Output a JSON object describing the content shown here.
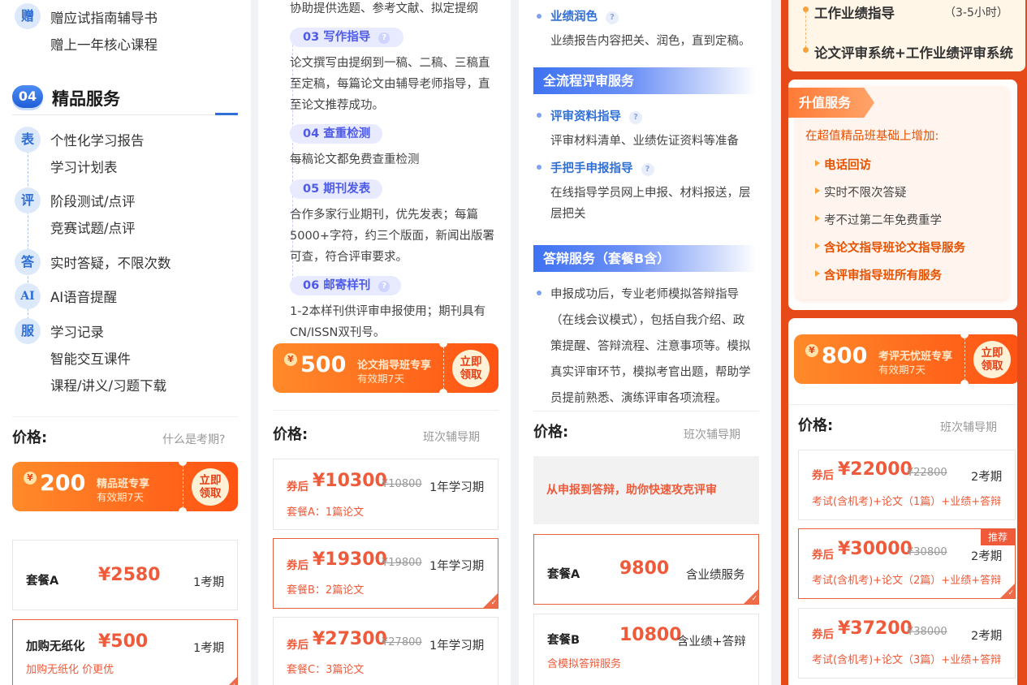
{
  "col1": {
    "gift_icon": "赠",
    "gift_items": [
      "赠应试指南辅导书",
      "赠上一年核心课程"
    ],
    "section_num": "04",
    "section_title": "精品服务",
    "groups": [
      {
        "icon": "表",
        "items": [
          "个性化学习报告",
          "学习计划表"
        ]
      },
      {
        "icon": "评",
        "items": [
          "阶段测试/点评",
          "竞赛试题/点评"
        ]
      },
      {
        "icon": "答",
        "items": [
          "实时答疑，不限次数"
        ]
      },
      {
        "icon": "AI",
        "items": [
          "AI语音提醒"
        ]
      },
      {
        "icon": "服",
        "items": [
          "学习记录",
          "智能交互课件",
          "课程/讲义/习题下载"
        ]
      }
    ],
    "price_label": "价格:",
    "price_note": "什么是考期?",
    "coupon": {
      "yen": "¥",
      "amount": "200",
      "title": "精品班专享",
      "sub": "有效期7天",
      "claim1": "立即",
      "claim2": "领取"
    },
    "plans": [
      {
        "name": "套餐A",
        "price": "¥2580",
        "period": "1考期",
        "sub": ""
      },
      {
        "name": "加购无纸化",
        "price": "¥500",
        "period": "1考期",
        "sub": "加购无纸化 价更优"
      }
    ]
  },
  "col2": {
    "top_text": "协助提供选题、参考文献、拟定提纲",
    "steps": [
      {
        "label": "03 写作指导",
        "text": [
          "论文撰写由提纲到一稿、二稿、三稿直",
          "至定稿，每篇论文由辅导老师指导，直",
          "至论文推荐成功。"
        ]
      },
      {
        "label": "04 查重检测",
        "text": [
          "每稿论文都免费查重检测"
        ]
      },
      {
        "label": "05 期刊发表",
        "text": [
          "合作多家行业期刊，优先发表；每篇",
          "5000+字符，约三个版面，新闻出版署",
          "可查，符合评审要求。"
        ]
      },
      {
        "label": "06 邮寄样刊",
        "text": [
          "1-2本样刊供评审申报使用；期刊具有",
          "CN/ISSN双刊号。"
        ]
      }
    ],
    "coupon": {
      "yen": "¥",
      "amount": "500",
      "title": "论文指导班专享",
      "sub": "有效期7天",
      "claim1": "立即",
      "claim2": "领取"
    },
    "price_label": "价格:",
    "price_note": "班次辅导期",
    "plans": [
      {
        "qh": "券后",
        "price": "¥10300",
        "orig": "¥10800",
        "period": "1年学习期",
        "sub": "套餐A：1篇论文"
      },
      {
        "qh": "券后",
        "price": "¥19300",
        "orig": "¥19800",
        "period": "1年学习期",
        "sub": "套餐B：2篇论文"
      },
      {
        "qh": "券后",
        "price": "¥27300",
        "orig": "¥27800",
        "period": "1年学习期",
        "sub": "套餐C：3篇论文"
      }
    ]
  },
  "col3": {
    "item1": {
      "title": "业绩润色",
      "text": "业绩报告内容把关、润色，直到定稿。"
    },
    "bar1": "全流程评审服务",
    "item2": {
      "title": "评审资料指导",
      "text": "评审材料清单、业绩佐证资料等准备"
    },
    "item3": {
      "title": "手把手申报指导",
      "text": [
        "在线指导学员网上申报、材料报送，层",
        "层把关"
      ]
    },
    "bar2": "答辩服务（套餐B含）",
    "item4": {
      "text": [
        "申报成功后，专业老师模拟答辩指导",
        "（在线会议模式），包括自我介绍、政",
        "策提醒、答辩流程、注意事项等。模拟",
        "真实评审环节，模拟考官出题，帮助学",
        "员提前熟悉、演练评审各项流程。"
      ]
    },
    "price_label": "价格:",
    "price_note": "班次辅导期",
    "banner": "从申报到答辩，助你快速攻克评审",
    "plans": [
      {
        "name": "套餐A",
        "price": "9800",
        "period": "含业绩服务",
        "sub": ""
      },
      {
        "name": "套餐B",
        "price": "10800",
        "period": "含业绩+答辩",
        "sub": "含模拟答辩服务"
      }
    ]
  },
  "col4": {
    "top_items": [
      {
        "label": "工作业绩指导",
        "hours": "（3-5小时）"
      },
      {
        "label": "论文评审系统+工作业绩评审系统",
        "hours": ""
      }
    ],
    "upgrade_tag": "升值服务",
    "upgrade_intro": "在超值精品班基础上增加:",
    "upgrade_items": [
      {
        "text": "电话回访",
        "hl": true
      },
      {
        "text": "实时不限次答疑",
        "hl": false
      },
      {
        "text": "考不过第二年免费重学",
        "hl": false
      },
      {
        "text": "含论文指导班论文指导服务",
        "hl": true
      },
      {
        "text": "含评审指导班所有服务",
        "hl": true
      }
    ],
    "coupon": {
      "yen": "¥",
      "amount": "800",
      "title": "考评无忧班专享",
      "sub": "有效期7天",
      "claim1": "立即",
      "claim2": "领取"
    },
    "price_label": "价格:",
    "price_note": "班次辅导期",
    "plans": [
      {
        "qh": "券后",
        "price": "¥22000",
        "orig": "¥22800",
        "period": "2考期",
        "sub": "考试(含机考)+论文（1篇）+业绩+答辩"
      },
      {
        "qh": "券后",
        "price": "¥30000",
        "orig": "¥30800",
        "period": "2考期",
        "sub": "考试(含机考)+论文（2篇）+业绩+答辩",
        "badge": "推荐"
      },
      {
        "qh": "券后",
        "price": "¥37200",
        "orig": "¥38000",
        "period": "2考期",
        "sub": "考试(含机考)+论文（3篇）+业绩+答辩"
      }
    ]
  },
  "colors": {
    "accent_blue": "#2f6fd6",
    "accent_orange": "#ff5313",
    "price_red": "#ee5a3a",
    "column4_bg": "#e64a19"
  }
}
